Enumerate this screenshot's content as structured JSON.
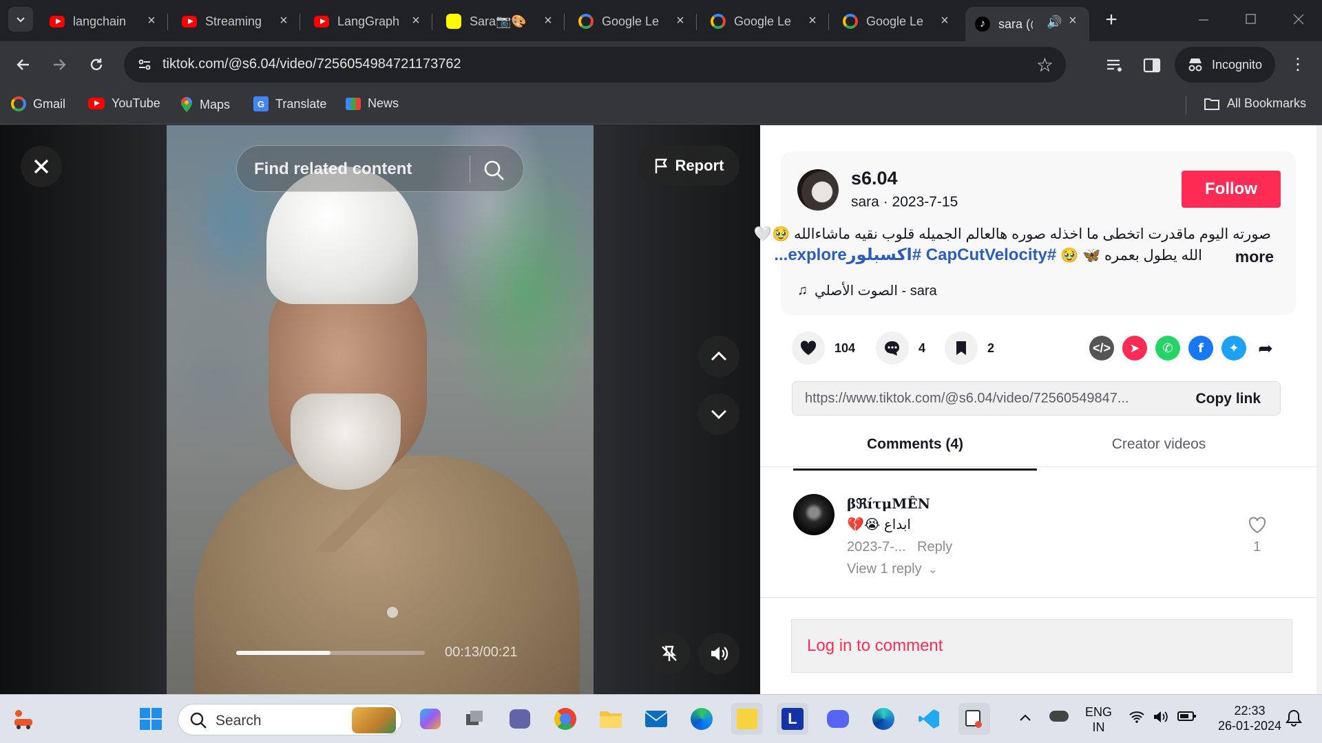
{
  "browser": {
    "tabs": [
      {
        "title": "langchain",
        "icon": "youtube-icon"
      },
      {
        "title": "Streaming",
        "icon": "youtube-icon"
      },
      {
        "title": "LangGraph",
        "icon": "youtube-icon"
      },
      {
        "title": "Sara📷🎨",
        "icon": "snapchat-icon"
      },
      {
        "title": "Google Le",
        "icon": "google-lens-icon"
      },
      {
        "title": "Google Le",
        "icon": "google-lens-icon"
      },
      {
        "title": "Google Le",
        "icon": "google-lens-icon"
      },
      {
        "title": "sara (@",
        "icon": "tiktok-icon",
        "active": true
      }
    ],
    "url": "tiktok.com/@s6.04/video/7256054984721173762",
    "incognito_label": "Incognito",
    "bookmarks": [
      {
        "label": "Gmail",
        "icon": "google-icon"
      },
      {
        "label": "YouTube",
        "icon": "youtube-icon"
      },
      {
        "label": "Maps",
        "icon": "maps-icon"
      },
      {
        "label": "Translate",
        "icon": "translate-icon"
      },
      {
        "label": "News",
        "icon": "news-icon"
      }
    ],
    "all_bookmarks": "All Bookmarks"
  },
  "video": {
    "search_placeholder": "Find related content",
    "report_label": "Report",
    "time": "00:13/00:21",
    "progress": 0.5
  },
  "post": {
    "username": "s6.04",
    "nickname": "sara",
    "date": "2023-7-15",
    "follow_label": "Follow",
    "desc_line1": "صورته اليوم ماقدرت اتخطى ما اخذله صوره هالعالم الجميله قلوب نقيه ماشاءالله 🥹🤍",
    "desc_line2_text": "الله يطول بعمره 🦋 🥹",
    "desc_tags": "#CapCutVelocity #اكسبلورexplore...",
    "more_label": "more",
    "music": "الصوت الأصلي - sara",
    "likes": "104",
    "comments": "4",
    "saves": "2",
    "share_link": "https://www.tiktok.com/@s6.04/video/72560549847...",
    "copy_link": "Copy link",
    "tab_comments": "Comments (4)",
    "tab_creator": "Creator videos",
    "accent": "#fe2c55",
    "comment": {
      "author": "βℜíτμMÊN",
      "text": "ابداع 😭💔",
      "date": "2023-7-...",
      "reply": "Reply",
      "view_replies": "View 1 reply",
      "likes": "1"
    },
    "login_label": "Log in to comment"
  },
  "taskbar": {
    "search_label": "Search",
    "lang_top": "ENG",
    "lang_bottom": "IN",
    "time": "22:33",
    "date": "26-01-2024"
  }
}
